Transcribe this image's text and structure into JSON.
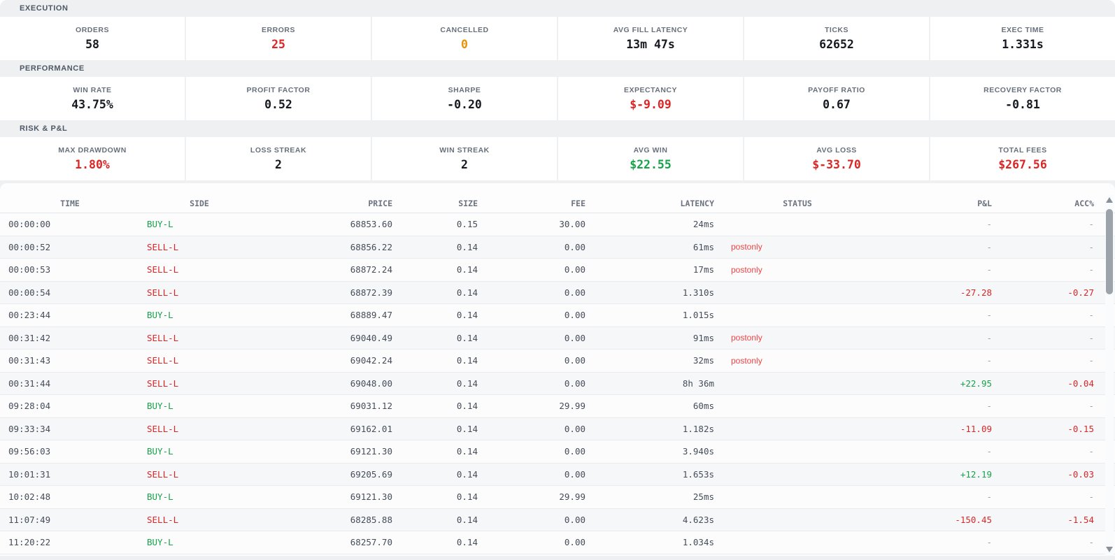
{
  "colors": {
    "red": "#dc2626",
    "green": "#16a34a",
    "orange": "#e8920a",
    "dark": "#161a20",
    "status_red": "#ef4444"
  },
  "sections": [
    {
      "title": "EXECUTION",
      "stats": [
        {
          "label": "ORDERS",
          "value": "58",
          "color": "dark"
        },
        {
          "label": "ERRORS",
          "value": "25",
          "color": "red"
        },
        {
          "label": "CANCELLED",
          "value": "0",
          "color": "orange"
        },
        {
          "label": "AVG FILL LATENCY",
          "value": "13m 47s",
          "color": "dark"
        },
        {
          "label": "TICKS",
          "value": "62652",
          "color": "dark"
        },
        {
          "label": "EXEC TIME",
          "value": "1.331s",
          "color": "dark"
        }
      ]
    },
    {
      "title": "PERFORMANCE",
      "stats": [
        {
          "label": "WIN RATE",
          "value": "43.75%",
          "color": "dark"
        },
        {
          "label": "PROFIT FACTOR",
          "value": "0.52",
          "color": "dark"
        },
        {
          "label": "SHARPE",
          "value": "-0.20",
          "color": "dark"
        },
        {
          "label": "EXPECTANCY",
          "value": "$-9.09",
          "color": "red"
        },
        {
          "label": "PAYOFF RATIO",
          "value": "0.67",
          "color": "dark"
        },
        {
          "label": "RECOVERY FACTOR",
          "value": "-0.81",
          "color": "dark"
        }
      ]
    },
    {
      "title": "RISK & P&L",
      "stats": [
        {
          "label": "MAX DRAWDOWN",
          "value": "1.80%",
          "color": "red"
        },
        {
          "label": "LOSS STREAK",
          "value": "2",
          "color": "dark"
        },
        {
          "label": "WIN STREAK",
          "value": "2",
          "color": "dark"
        },
        {
          "label": "AVG WIN",
          "value": "$22.55",
          "color": "green"
        },
        {
          "label": "AVG LOSS",
          "value": "$-33.70",
          "color": "red"
        },
        {
          "label": "TOTAL FEES",
          "value": "$267.56",
          "color": "red"
        }
      ]
    }
  ],
  "table": {
    "columns": [
      "TIME",
      "SIDE",
      "PRICE",
      "SIZE",
      "FEE",
      "LATENCY",
      "STATUS",
      "P&L",
      "ACC%"
    ],
    "rows": [
      {
        "time": "00:00:00",
        "side": "BUY-L",
        "side_color": "buy",
        "price": "68853.60",
        "size": "0.15",
        "fee": "30.00",
        "latency": "24ms",
        "status": "",
        "pnl": "-",
        "pnl_color": "muted",
        "acc": "-",
        "acc_color": "muted"
      },
      {
        "time": "00:00:52",
        "side": "SELL-L",
        "side_color": "sell",
        "price": "68856.22",
        "size": "0.14",
        "fee": "0.00",
        "latency": "61ms",
        "status": "postonly",
        "pnl": "-",
        "pnl_color": "muted",
        "acc": "-",
        "acc_color": "muted"
      },
      {
        "time": "00:00:53",
        "side": "SELL-L",
        "side_color": "sell",
        "price": "68872.24",
        "size": "0.14",
        "fee": "0.00",
        "latency": "17ms",
        "status": "postonly",
        "pnl": "-",
        "pnl_color": "muted",
        "acc": "-",
        "acc_color": "muted"
      },
      {
        "time": "00:00:54",
        "side": "SELL-L",
        "side_color": "sell",
        "price": "68872.39",
        "size": "0.14",
        "fee": "0.00",
        "latency": "1.310s",
        "status": "",
        "pnl": "-27.28",
        "pnl_color": "red",
        "acc": "-0.27",
        "acc_color": "red"
      },
      {
        "time": "00:23:44",
        "side": "BUY-L",
        "side_color": "buy",
        "price": "68889.47",
        "size": "0.14",
        "fee": "0.00",
        "latency": "1.015s",
        "status": "",
        "pnl": "-",
        "pnl_color": "muted",
        "acc": "-",
        "acc_color": "muted"
      },
      {
        "time": "00:31:42",
        "side": "SELL-L",
        "side_color": "sell",
        "price": "69040.49",
        "size": "0.14",
        "fee": "0.00",
        "latency": "91ms",
        "status": "postonly",
        "pnl": "-",
        "pnl_color": "muted",
        "acc": "-",
        "acc_color": "muted"
      },
      {
        "time": "00:31:43",
        "side": "SELL-L",
        "side_color": "sell",
        "price": "69042.24",
        "size": "0.14",
        "fee": "0.00",
        "latency": "32ms",
        "status": "postonly",
        "pnl": "-",
        "pnl_color": "muted",
        "acc": "-",
        "acc_color": "muted"
      },
      {
        "time": "00:31:44",
        "side": "SELL-L",
        "side_color": "sell",
        "price": "69048.00",
        "size": "0.14",
        "fee": "0.00",
        "latency": "8h 36m",
        "status": "",
        "pnl": "+22.95",
        "pnl_color": "green",
        "acc": "-0.04",
        "acc_color": "red"
      },
      {
        "time": "09:28:04",
        "side": "BUY-L",
        "side_color": "buy",
        "price": "69031.12",
        "size": "0.14",
        "fee": "29.99",
        "latency": "60ms",
        "status": "",
        "pnl": "-",
        "pnl_color": "muted",
        "acc": "-",
        "acc_color": "muted"
      },
      {
        "time": "09:33:34",
        "side": "SELL-L",
        "side_color": "sell",
        "price": "69162.01",
        "size": "0.14",
        "fee": "0.00",
        "latency": "1.182s",
        "status": "",
        "pnl": "-11.09",
        "pnl_color": "red",
        "acc": "-0.15",
        "acc_color": "red"
      },
      {
        "time": "09:56:03",
        "side": "BUY-L",
        "side_color": "buy",
        "price": "69121.30",
        "size": "0.14",
        "fee": "0.00",
        "latency": "3.940s",
        "status": "",
        "pnl": "-",
        "pnl_color": "muted",
        "acc": "-",
        "acc_color": "muted"
      },
      {
        "time": "10:01:31",
        "side": "SELL-L",
        "side_color": "sell",
        "price": "69205.69",
        "size": "0.14",
        "fee": "0.00",
        "latency": "1.653s",
        "status": "",
        "pnl": "+12.19",
        "pnl_color": "green",
        "acc": "-0.03",
        "acc_color": "red"
      },
      {
        "time": "10:02:48",
        "side": "BUY-L",
        "side_color": "buy",
        "price": "69121.30",
        "size": "0.14",
        "fee": "29.99",
        "latency": "25ms",
        "status": "",
        "pnl": "-",
        "pnl_color": "muted",
        "acc": "-",
        "acc_color": "muted"
      },
      {
        "time": "11:07:49",
        "side": "SELL-L",
        "side_color": "sell",
        "price": "68285.88",
        "size": "0.14",
        "fee": "0.00",
        "latency": "4.623s",
        "status": "",
        "pnl": "-150.45",
        "pnl_color": "red",
        "acc": "-1.54",
        "acc_color": "red"
      },
      {
        "time": "11:20:22",
        "side": "BUY-L",
        "side_color": "buy",
        "price": "68257.70",
        "size": "0.14",
        "fee": "0.00",
        "latency": "1.034s",
        "status": "",
        "pnl": "-",
        "pnl_color": "muted",
        "acc": "-",
        "acc_color": "muted"
      }
    ]
  }
}
